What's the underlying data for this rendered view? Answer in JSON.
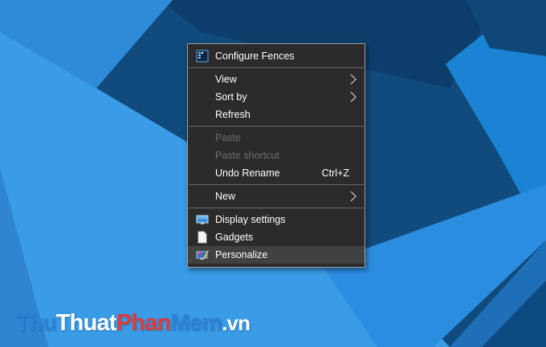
{
  "context_menu": {
    "configure_fences": "Configure Fences",
    "view": "View",
    "sort_by": "Sort by",
    "refresh": "Refresh",
    "paste": "Paste",
    "paste_shortcut": "Paste shortcut",
    "undo_rename": "Undo Rename",
    "undo_shortcut": "Ctrl+Z",
    "new": "New",
    "display_settings": "Display settings",
    "gadgets": "Gadgets",
    "personalize": "Personalize"
  },
  "watermark": {
    "thu": "Thu",
    "thuat": "Thuat",
    "phan": "Phan",
    "mem": "Mem",
    "vn": ".vn"
  },
  "colors": {
    "menu_background": "#2b2b2b",
    "menu_hover": "#414141",
    "desktop_dark": "#114a7c",
    "desktop_light": "#3a9be6"
  },
  "icons": [
    "fences-icon",
    "chevron-right-icon",
    "display-icon",
    "gadgets-icon",
    "personalize-icon"
  ]
}
